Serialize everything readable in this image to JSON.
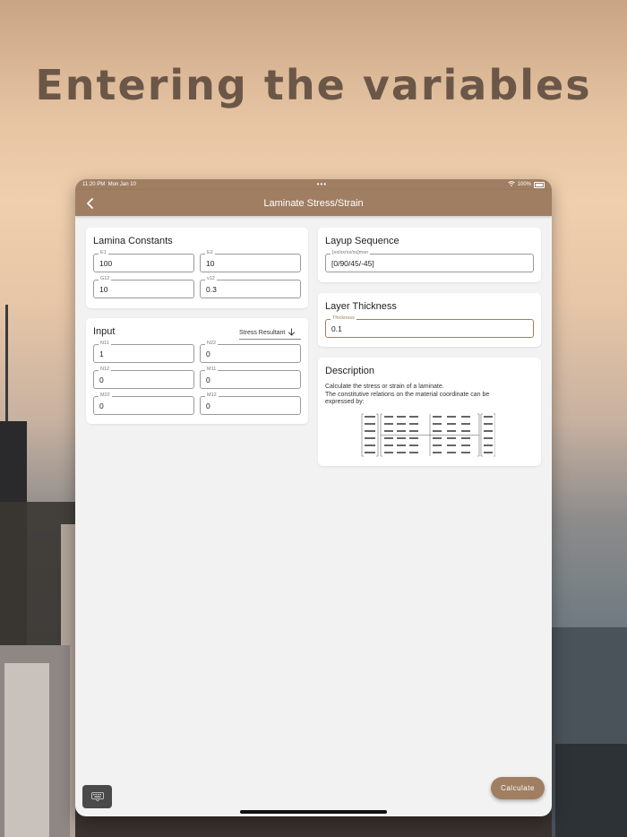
{
  "headline": "Entering the variables",
  "status": {
    "time": "11:20 PM",
    "date": "Mon Jan 10",
    "battery": "100%"
  },
  "nav": {
    "title": "Laminate Stress/Strain"
  },
  "lamina": {
    "title": "Lamina Constants",
    "e1": {
      "label": "E1",
      "value": "100"
    },
    "e2": {
      "label": "E2",
      "value": "10"
    },
    "g12": {
      "label": "G12",
      "value": "10"
    },
    "v12": {
      "label": "v12",
      "value": "0.3"
    }
  },
  "input": {
    "title": "Input",
    "mode": "Stress Resultant",
    "n11": {
      "label": "N11",
      "value": "1"
    },
    "n22": {
      "label": "N22",
      "value": "0"
    },
    "n12": {
      "label": "N12",
      "value": "0"
    },
    "m11": {
      "label": "M11",
      "value": "0"
    },
    "m22": {
      "label": "M22",
      "value": "0"
    },
    "m12": {
      "label": "M12",
      "value": "0"
    }
  },
  "layup": {
    "title": "Layup Sequence",
    "label": "[xx/xx/xx/xx]msn",
    "value": "[0/90/45/-45]"
  },
  "thickness": {
    "title": "Layer Thickness",
    "label": "Thickness",
    "value": "0.1"
  },
  "description": {
    "title": "Description",
    "line1": "Calculate the stress or strain of a laminate.",
    "line2": "The constitutive relations on the material coordinate can be",
    "line3": "expressed by:"
  },
  "actions": {
    "calculate": "Calculate"
  },
  "colors": {
    "accent": "#a07e62",
    "card": "#ffffff",
    "screen_bg": "#f2f2f2"
  },
  "icons": {
    "back": "chevron-left-icon",
    "sort": "arrow-down-icon",
    "keyboard": "keyboard-icon",
    "wifi": "wifi-icon",
    "battery": "battery-icon"
  }
}
